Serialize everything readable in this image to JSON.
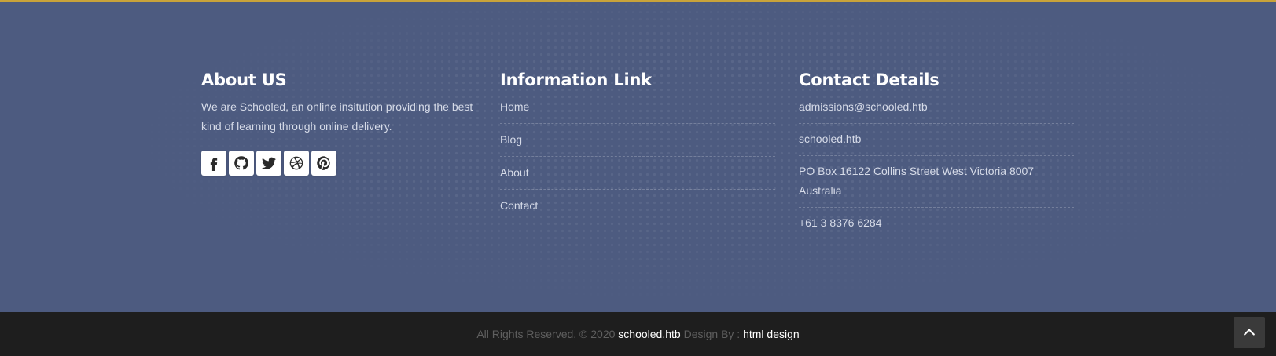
{
  "about": {
    "title": "About US",
    "text": "We are Schooled, an online insitution providing the best kind of learning through online delivery.",
    "social_icons": [
      "facebook-icon",
      "github-icon",
      "twitter-icon",
      "dribbble-icon",
      "pinterest-icon"
    ]
  },
  "info": {
    "title": "Information Link",
    "links": [
      "Home",
      "Blog",
      "About",
      "Contact"
    ]
  },
  "contact": {
    "title": "Contact Details",
    "items": [
      "admissions@schooled.htb",
      "schooled.htb",
      "PO Box 16122 Collins Street West Victoria 8007 Australia",
      "+61 3 8376 6284"
    ]
  },
  "bottom": {
    "prefix": "All Rights Reserved. © 2020",
    "site": "schooled.htb",
    "design_by": "Design By :",
    "designer": "html design"
  },
  "colors": {
    "footer_bg": "#4d5b80",
    "top_border": "#c9a33a",
    "bottom_bg": "#1e1e1e"
  }
}
